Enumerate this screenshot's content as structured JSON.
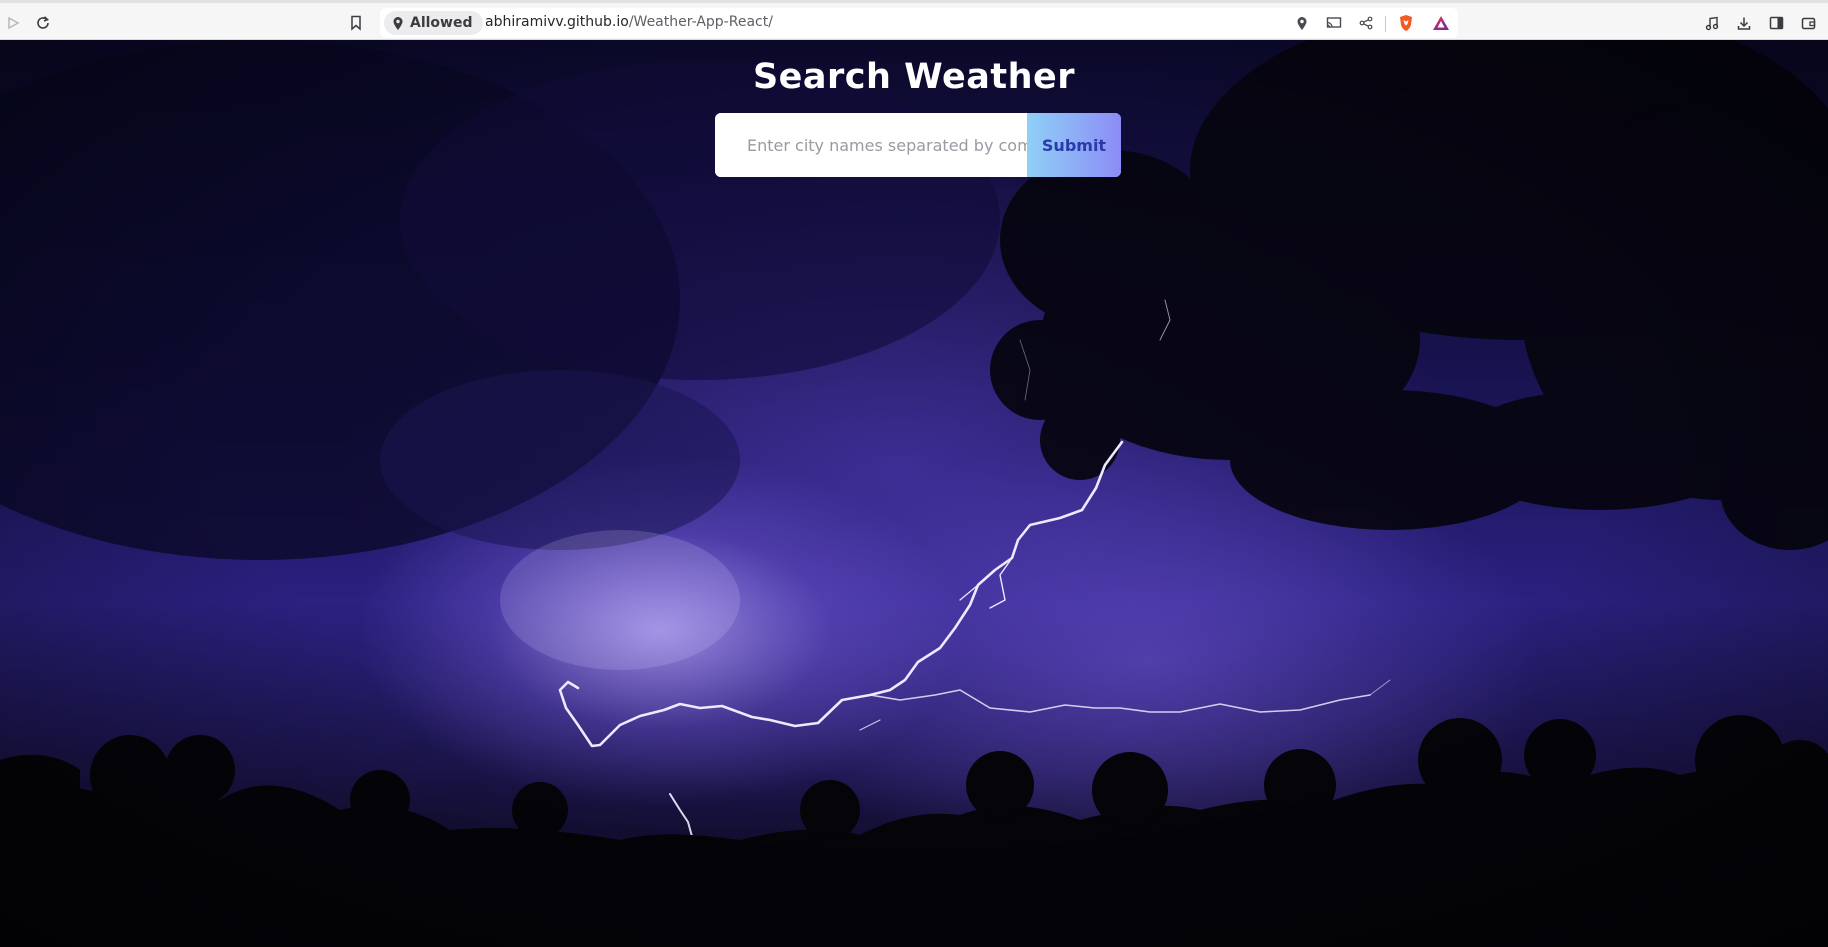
{
  "browser": {
    "permission_label": "Allowed",
    "url_domain": "abhiramivv.github.io",
    "url_path": "/Weather-App-React/",
    "icons": {
      "left": [
        "play-icon",
        "reload-icon",
        "bookmark-icon"
      ],
      "url_right": [
        "location-icon",
        "cast-icon",
        "share-icon",
        "brave-shields-icon",
        "brave-rewards-icon"
      ],
      "far_right": [
        "media-icon",
        "download-icon",
        "sidebar-icon",
        "wallet-icon"
      ]
    }
  },
  "page": {
    "title": "Search Weather",
    "search": {
      "placeholder": "Enter city names separated by commas",
      "value": ""
    },
    "submit_label": "Submit",
    "background": "night-thunderstorm-lightning-photo"
  },
  "colors": {
    "title": "#ffffff",
    "submit_gradient_start": "#8fd0f7",
    "submit_gradient_end": "#8c8cf5",
    "submit_text": "#2a3aa8",
    "sky_accent": "#2a2180"
  }
}
